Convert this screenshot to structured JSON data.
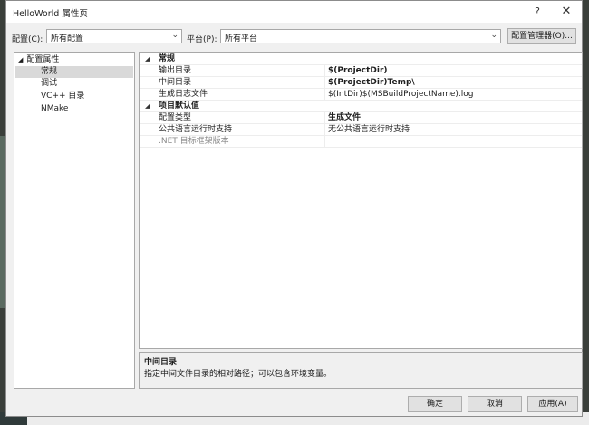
{
  "window": {
    "title": "HelloWorld 属性页",
    "help": "?",
    "close": "✕"
  },
  "toolbar": {
    "config_label": "配置(C):",
    "config_value": "所有配置",
    "platform_label": "平台(P):",
    "platform_value": "所有平台",
    "config_manager": "配置管理器(O)..."
  },
  "tree": {
    "root": "配置属性",
    "items": [
      "常规",
      "调试",
      "VC++ 目录",
      "NMake"
    ]
  },
  "grid": {
    "categories": [
      {
        "label": "常规",
        "props": [
          {
            "name": "输出目录",
            "value": "$(ProjectDir)"
          },
          {
            "name": "中间目录",
            "value": "$(ProjectDir)Temp\\"
          },
          {
            "name": "生成日志文件",
            "value": "$(IntDir)$(MSBuildProjectName).log"
          }
        ]
      },
      {
        "label": "项目默认值",
        "props": [
          {
            "name": "配置类型",
            "value": "生成文件"
          },
          {
            "name": "公共语言运行时支持",
            "value": "无公共语言运行时支持"
          },
          {
            "name": ".NET 目标框架版本",
            "value": ""
          }
        ]
      }
    ]
  },
  "description": {
    "title": "中间目录",
    "text": "指定中间文件目录的相对路径；可以包含环境变量。"
  },
  "buttons": {
    "ok": "确定",
    "cancel": "取消",
    "apply": "应用(A)"
  }
}
